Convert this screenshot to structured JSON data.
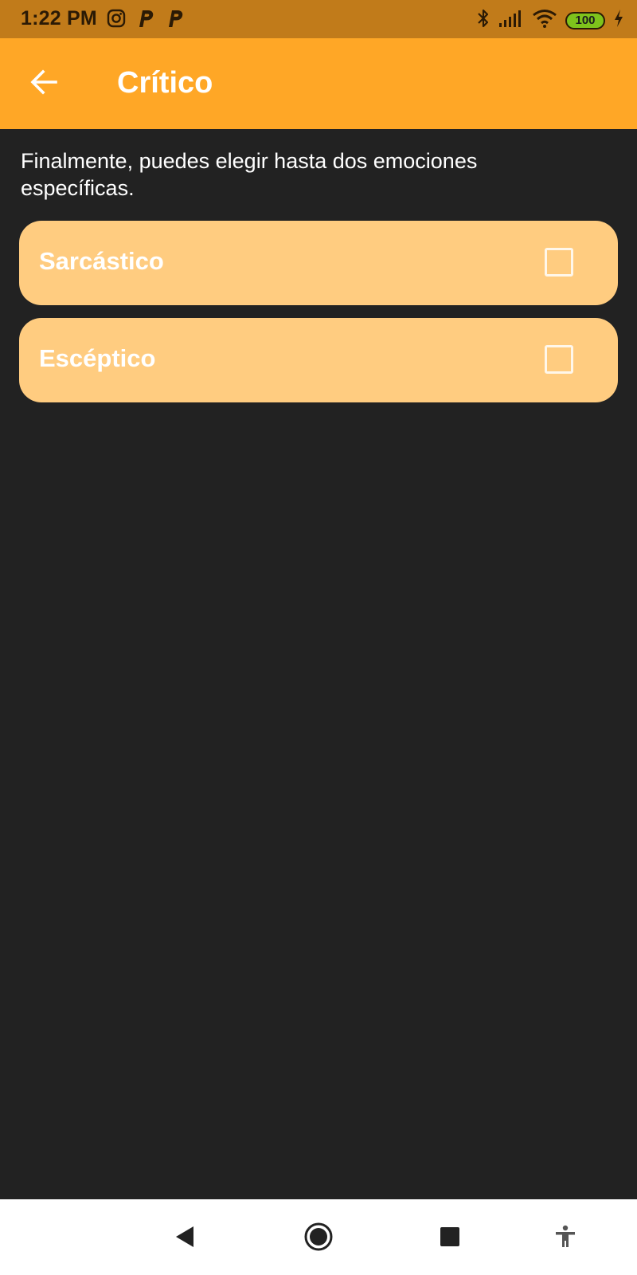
{
  "status_bar": {
    "time": "1:22 PM",
    "left_icons": [
      "instagram-icon",
      "p-app-icon",
      "p-app-icon"
    ],
    "right_icons": [
      "bluetooth-icon",
      "signal-icon",
      "wifi-icon",
      "battery-icon",
      "charging-icon"
    ],
    "battery_level": "100",
    "background_color": "#c17b1a"
  },
  "app_bar": {
    "title": "Crítico",
    "back_icon": "arrow-left-icon",
    "background_color": "#ffa726"
  },
  "main": {
    "instruction": "Finalmente, puedes elegir hasta dos emociones específicas.",
    "options": [
      {
        "label": "Sarcástico",
        "checked": false
      },
      {
        "label": "Escéptico",
        "checked": false
      }
    ],
    "option_color": "#ffcc80",
    "background_color": "#222222"
  },
  "nav_bar": {
    "buttons": [
      "back-triangle-icon",
      "home-circle-icon",
      "recents-square-icon",
      "accessibility-icon"
    ]
  }
}
